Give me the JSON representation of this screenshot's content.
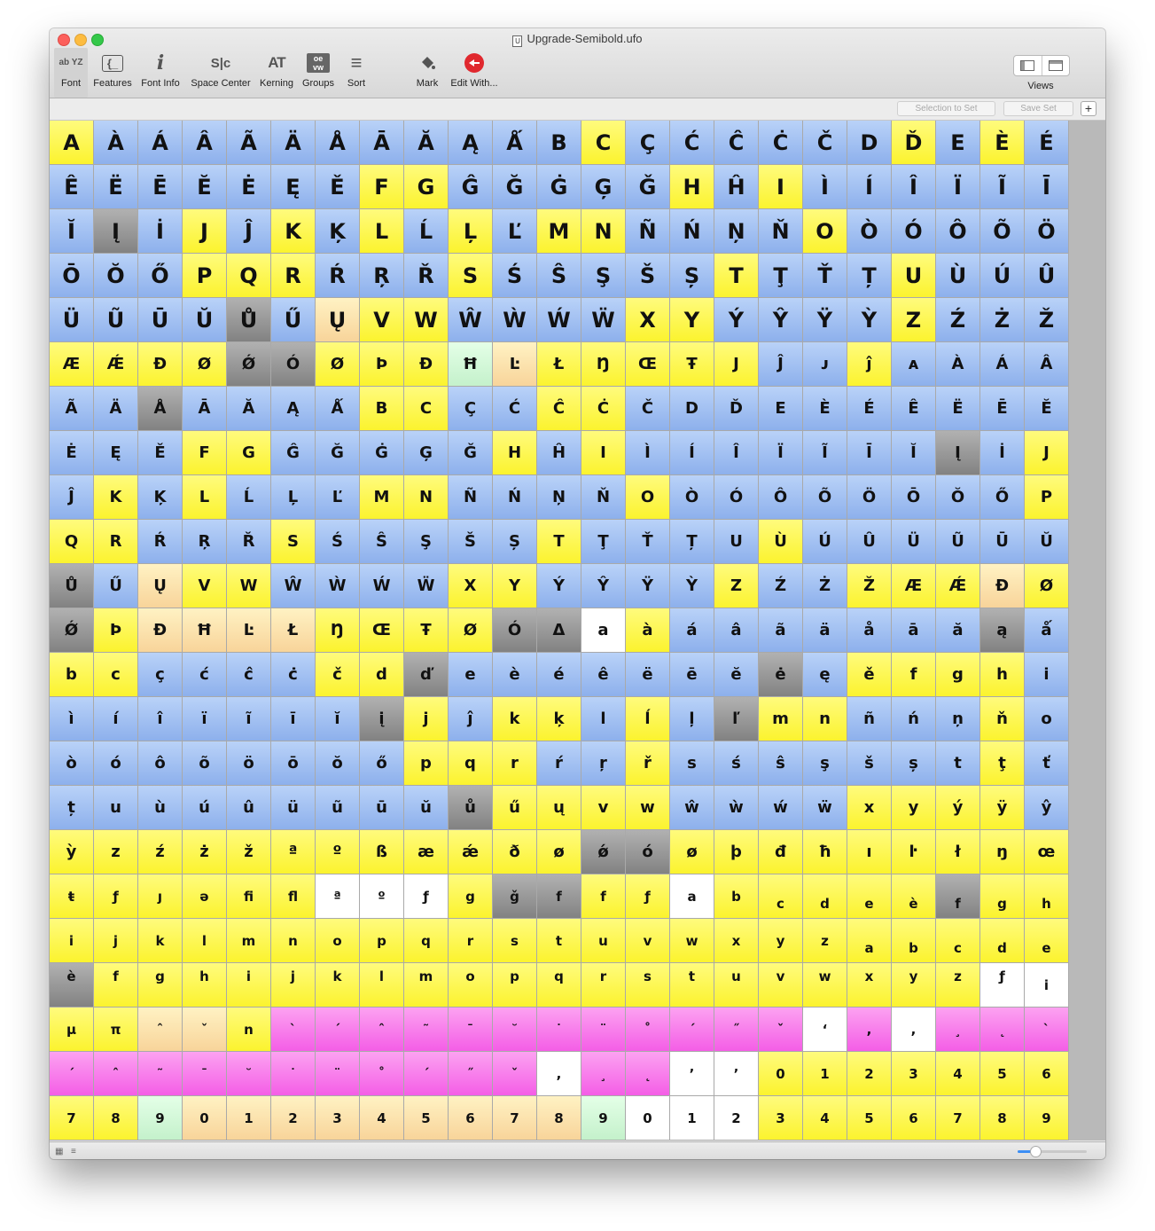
{
  "window": {
    "title": "Upgrade-Semibold.ufo"
  },
  "toolbar": {
    "font": "Font",
    "features": "Features",
    "font_info": "Font Info",
    "space_center": "Space Center",
    "kerning": "Kerning",
    "groups": "Groups",
    "sort": "Sort",
    "mark": "Mark",
    "edit_with": "Edit With...",
    "views": "Views",
    "font_icon_text": "ab YZ",
    "features_icon_text": "{_",
    "font_info_icon_text": "i",
    "space_center_icon_text": "S|c",
    "kerning_icon_text": "AT",
    "groups_icon_text": "oe vw",
    "sort_icon_text": "≡"
  },
  "setbar": {
    "selection_to_set": "Selection to Set",
    "save_set": "Save Set",
    "add": "+"
  },
  "colors": {
    "blue": "#9dbcf1",
    "yellow": "#fbf32e",
    "gray": "#8e8e8e",
    "orange": "#f8d49a",
    "green": "#c4f1cb",
    "white": "#ffffff",
    "magenta": "#f45ee6",
    "accent": "#3c8ef5"
  },
  "glyph_rows": [
    "A À Á Â Ã Ä Å Ā Ă Ą Ǻ B C Ç Ć Ĉ Ċ Č D Ď E È É",
    "Ê Ë Ē Ĕ Ė Ę Ě F G Ĝ Ğ Ġ Ģ Ǧ H Ĥ I Ì Í Î Ï Ĩ Ī",
    "Ĭ Į İ J Ĵ K Ķ L Ĺ Ļ Ľ M N Ñ Ń Ņ Ň O Ò Ó Ô Õ Ö",
    "Ō Ŏ Ő P Q R Ŕ Ŗ Ř S Ś Ŝ Ş Š Ș T Ţ Ť Ț U Ù Ú Û",
    "Ü Ũ Ū Ŭ Ů Ű Ų V W Ŵ Ẁ Ẃ Ẅ X Y Ý Ŷ Ÿ Ỳ Z Ź Ż Ž",
    "Æ Ǽ Đ Ø Ǿ Ó Ø Þ Đ Ħ Ŀ Ł Ŋ Œ Ŧ J Ĵ ᴊ ĵ ᴀ À Á Â",
    "Ã Ä Å Ā Ă Ą Ǻ B C Ç Ć Ĉ Ċ Č D Ď E È É Ê Ë Ē Ĕ",
    "Ė Ę Ě F G Ĝ Ğ Ġ Ģ Ǧ H Ĥ I Ì Í Î Ï Ĩ Ī Ĭ Į İ J",
    "Ĵ K Ķ L Ĺ Ļ Ľ M N Ñ Ń Ņ Ň O Ò Ó Ô Õ Ö Ō Ŏ Ő P",
    "Q R Ŕ Ŗ Ř S Ś Ŝ Ş Š Ș T Ţ Ť Ț U Ù Ú Û Ü Ũ Ū Ŭ",
    "Ů Ű Ų V W Ŵ Ẁ Ẃ Ẅ X Y Ý Ŷ Ÿ Ỳ Z Ź Ż Ž Æ Ǽ Đ Ø",
    "Ǿ Þ Đ Ħ Ŀ Ł Ŋ Œ Ŧ Ø Ó Δ a à á â ã ä å ā ă ą ǻ",
    "b c ç ć ĉ ċ č d ď e è é ê ë ē ĕ ė ę ě f g h i",
    "ì í î ï ĩ ī ĭ į j ĵ k ķ l ĺ ļ ľ m n ñ ń ņ ň o",
    "ò ó ô õ ö ō ŏ ő p q r ŕ ŗ ř s ś ŝ ş š ș t ţ ť",
    "ț u ù ú û ü ũ ū ŭ ů ű ų v w ŵ ẁ ẃ ẅ x y ý ÿ ŷ",
    "ỳ z ź ż ž ª º ß æ ǽ ð ø ǿ ó ø þ đ ħ ı ŀ ł ŋ œ",
    "ŧ ƒ ȷ ə ﬁ ﬂ ª º ƒ g ǧ f f ƒ a b c d e è f g h",
    "i j k l m n o p q r s t u v w x y z a b c d e",
    "è f g h i j k l m o p q r s t u v w x y z ƒ i",
    "µ π ˆ ˇ n ` ´ ˆ ˜ ¯ ˘ ˙ ¨ ˚ ΄ ˝ ˇ ‘ , , ¸ ˛ `",
    "´ ˆ ˜ ¯ ˘ ˙ ¨ ˚ ΄ ˝ ˇ , ¸ ˛ ’ ’ 0 1 2 3 4 5 6",
    "7 8 9 0 1 2 3 4 5 6 7 8 9 0 1 2 3 4 5 6 7 8 9"
  ],
  "color_rows": [
    "yBBBBBBBBBBByBBBBBByByBB",
    "BBBBBBByyBBBBByByBBBBB",
    "BgByByByByByyBBBByBBBBB",
    "BBByyyBBByBBBBByBBByBBB",
    "BBBBgBoyyBBBByyBBBByBBB",
    "yyyygg yyyrol yyyyyBByBBB",
    "BBgBBBByyBByyBBBBBBBBB",
    "BBByyBBBBByByBBBBBBBgBy",
    "ByByBBByyBBBByBBBBBBBBy",
    "yyBBByBBBBByBBBByBBBBBB",
    "gBoyyBBBByyBBBByBByyyoy",
    "gyooooyyyyggwyBBBBBBBgB",
    "yyBBBByyge BBBBBBBgByyyy",
    "BBBBBBBgyBybyByBgyyBBBy",
    "BBBBBBBByyyBByBBBBBBByBg",
    "BBBBBBBBBgyyyyBBBByyyy",
    "yyyyyyyyyyyyggyyyyyyyyy",
    "yyyyyywwwyggyyw yyyyygyyy",
    "yyyyyyyyyyyyyyyyyyyyyyy",
    "gyyyyyyyyyyyyyyyyyyyyww",
    "yyooymmmmmmmmmmmmwmwmmm",
    "mmmmmmmmmmmwmmwwyyyyyyy",
    "yyrooooooooorwwwyyyyyyyw"
  ]
}
